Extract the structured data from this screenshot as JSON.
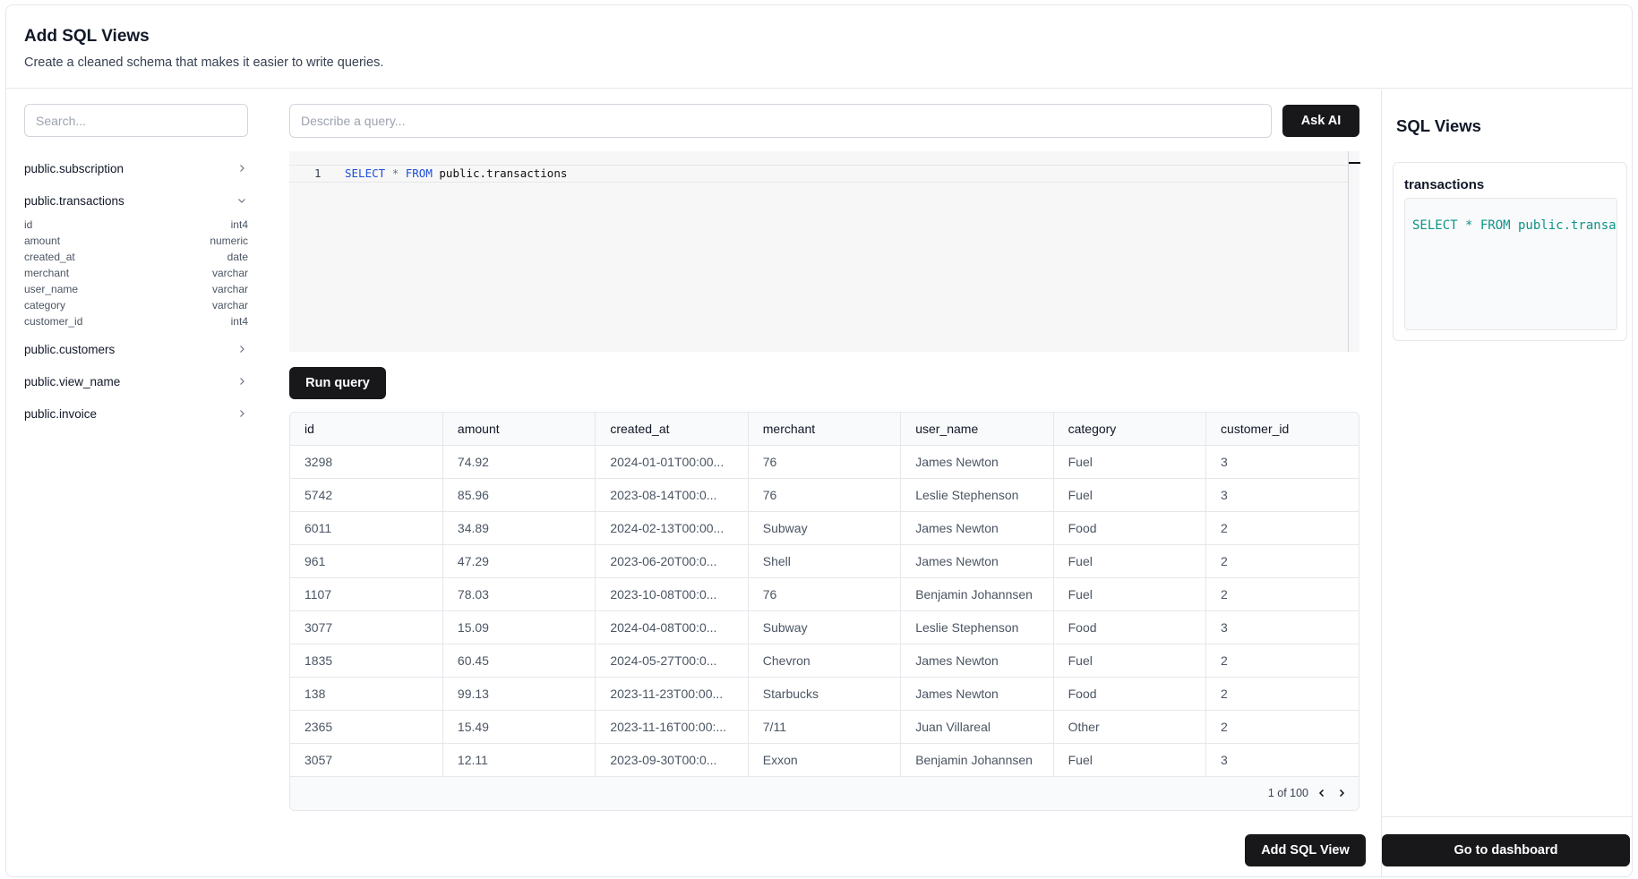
{
  "header": {
    "title": "Add SQL Views",
    "subtitle": "Create a cleaned schema that makes it easier to write queries."
  },
  "sidebar": {
    "search_placeholder": "Search...",
    "tables": [
      {
        "name": "public.subscription",
        "expanded": false,
        "icon": "chevron-right-icon"
      },
      {
        "name": "public.transactions",
        "expanded": true,
        "icon": "chevron-down-icon",
        "columns": [
          {
            "name": "id",
            "type": "int4"
          },
          {
            "name": "amount",
            "type": "numeric"
          },
          {
            "name": "created_at",
            "type": "date"
          },
          {
            "name": "merchant",
            "type": "varchar"
          },
          {
            "name": "user_name",
            "type": "varchar"
          },
          {
            "name": "category",
            "type": "varchar"
          },
          {
            "name": "customer_id",
            "type": "int4"
          }
        ]
      },
      {
        "name": "public.customers",
        "expanded": false,
        "icon": "chevron-right-icon"
      },
      {
        "name": "public.view_name",
        "expanded": false,
        "icon": "chevron-right-icon"
      },
      {
        "name": "public.invoice",
        "expanded": false,
        "icon": "chevron-right-icon"
      }
    ]
  },
  "main": {
    "ai_placeholder": "Describe a query...",
    "ask_ai_label": "Ask AI",
    "editor": {
      "line_number": "1",
      "tokens": {
        "select": "SELECT",
        "star": "*",
        "from": "FROM",
        "table": "public.transactions"
      }
    },
    "run_query_label": "Run query",
    "results": {
      "columns": [
        "id",
        "amount",
        "created_at",
        "merchant",
        "user_name",
        "category",
        "customer_id"
      ],
      "rows": [
        [
          "3298",
          "74.92",
          "2024-01-01T00:00...",
          "76",
          "James Newton",
          "Fuel",
          "3"
        ],
        [
          "5742",
          "85.96",
          "2023-08-14T00:0...",
          "76",
          "Leslie Stephenson",
          "Fuel",
          "3"
        ],
        [
          "6011",
          "34.89",
          "2024-02-13T00:00...",
          "Subway",
          "James Newton",
          "Food",
          "2"
        ],
        [
          "961",
          "47.29",
          "2023-06-20T00:0...",
          "Shell",
          "James Newton",
          "Fuel",
          "2"
        ],
        [
          "1107",
          "78.03",
          "2023-10-08T00:0...",
          "76",
          "Benjamin Johannsen",
          "Fuel",
          "2"
        ],
        [
          "3077",
          "15.09",
          "2024-04-08T00:0...",
          "Subway",
          "Leslie Stephenson",
          "Food",
          "3"
        ],
        [
          "1835",
          "60.45",
          "2024-05-27T00:0...",
          "Chevron",
          "James Newton",
          "Fuel",
          "2"
        ],
        [
          "138",
          "99.13",
          "2023-11-23T00:00...",
          "Starbucks",
          "James Newton",
          "Food",
          "2"
        ],
        [
          "2365",
          "15.49",
          "2023-11-16T00:00:...",
          "7/11",
          "Juan Villareal",
          "Other",
          "2"
        ],
        [
          "3057",
          "12.11",
          "2023-09-30T00:0...",
          "Exxon",
          "Benjamin Johannsen",
          "Fuel",
          "3"
        ]
      ],
      "pagination": "1 of 100"
    },
    "add_view_label": "Add SQL View"
  },
  "right_panel": {
    "title": "SQL Views",
    "views": [
      {
        "name": "transactions",
        "sql": "SELECT * FROM public.transactions"
      }
    ],
    "dashboard_label": "Go to dashboard"
  },
  "colors": {
    "button_bg": "#18181b",
    "border": "#e5e7eb",
    "keyword": "#1d4ed8",
    "view_code": "#0d9488"
  }
}
